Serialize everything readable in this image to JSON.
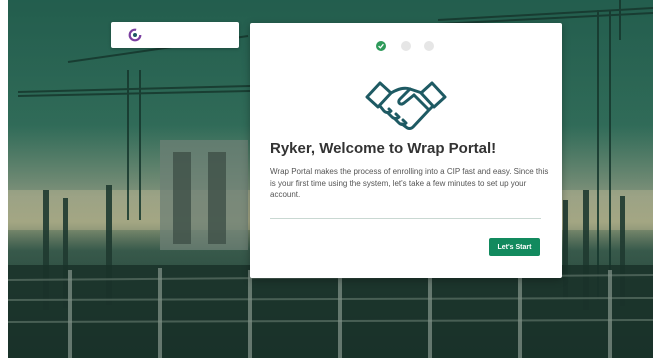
{
  "welcome": {
    "title": "Ryker, Welcome to Wrap Portal!",
    "description": "Wrap Portal makes the process of enrolling into a CIP fast and easy. Since this is your first time using the system, let's take a few minutes to set up your account.",
    "start_button_label": "Let's Start"
  },
  "steps": [
    {
      "status": "complete"
    },
    {
      "status": "pending"
    },
    {
      "status": "pending"
    }
  ],
  "icons": {
    "logo": "wrap-portal-logo-icon",
    "welcome": "handshake-icon",
    "step_done": "check-icon"
  },
  "colors": {
    "accent": "#128a5e",
    "step_complete": "#2e9a5a",
    "step_pending": "#e6e6e6",
    "icon_teal": "#1e5a63",
    "logo_purple": "#7b3fa0"
  }
}
